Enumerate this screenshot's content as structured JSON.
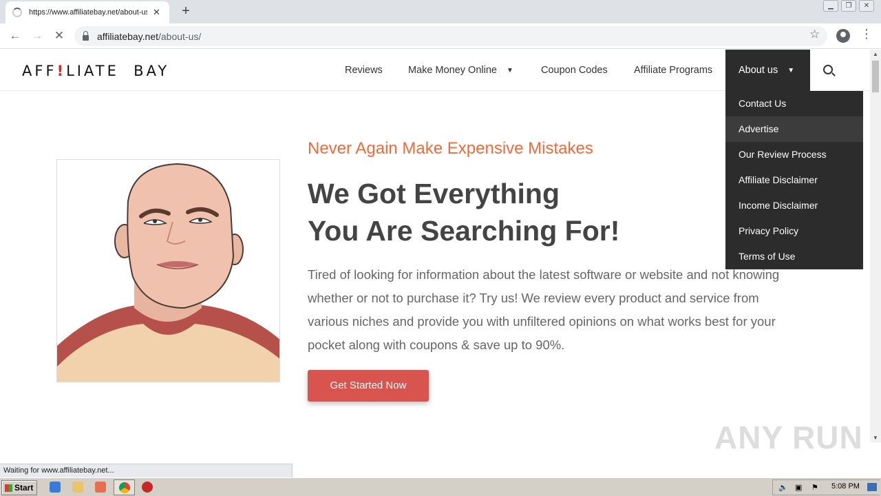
{
  "browser": {
    "tab_title": "https://www.affiliatebay.net/about-us/",
    "new_tab_label": "+",
    "url_domain": "affiliatebay.net",
    "url_path": "/about-us/",
    "status_text": "Waiting for www.affiliatebay.net..."
  },
  "site": {
    "logo_part1": "AFF",
    "logo_mark": "!",
    "logo_part2": "LIATE  BAY",
    "nav": {
      "reviews": "Reviews",
      "make_money": "Make Money Online",
      "coupons": "Coupon Codes",
      "affiliate_programs": "Affiliate Programs",
      "about": "About us"
    },
    "dropdown": [
      "Contact Us",
      "Advertise",
      "Our Review Process",
      "Affiliate Disclaimer",
      "Income Disclaimer",
      "Privacy Policy",
      "Terms of Use"
    ],
    "tagline": "Never Again Make Expensive Mistakes",
    "headline_line1": "We Got Everything",
    "headline_line2": "You Are Searching For!",
    "body": "Tired of looking for information about the latest software or website and not knowing whether or not to purchase it? Try us! We review every product and service from various niches and provide you with unfiltered opinions on what works best for your pocket along with coupons & save up to 90%.",
    "cta": "Get Started Now",
    "watermark": "ANY RUN"
  },
  "taskbar": {
    "start_label": "Start",
    "clock": "5:08 PM"
  },
  "colors": {
    "accent_orange": "#ef6b3c",
    "cta_red": "#d9534f",
    "menu_dark": "#2c2c2c",
    "menu_highlight": "#3c3c3c"
  }
}
